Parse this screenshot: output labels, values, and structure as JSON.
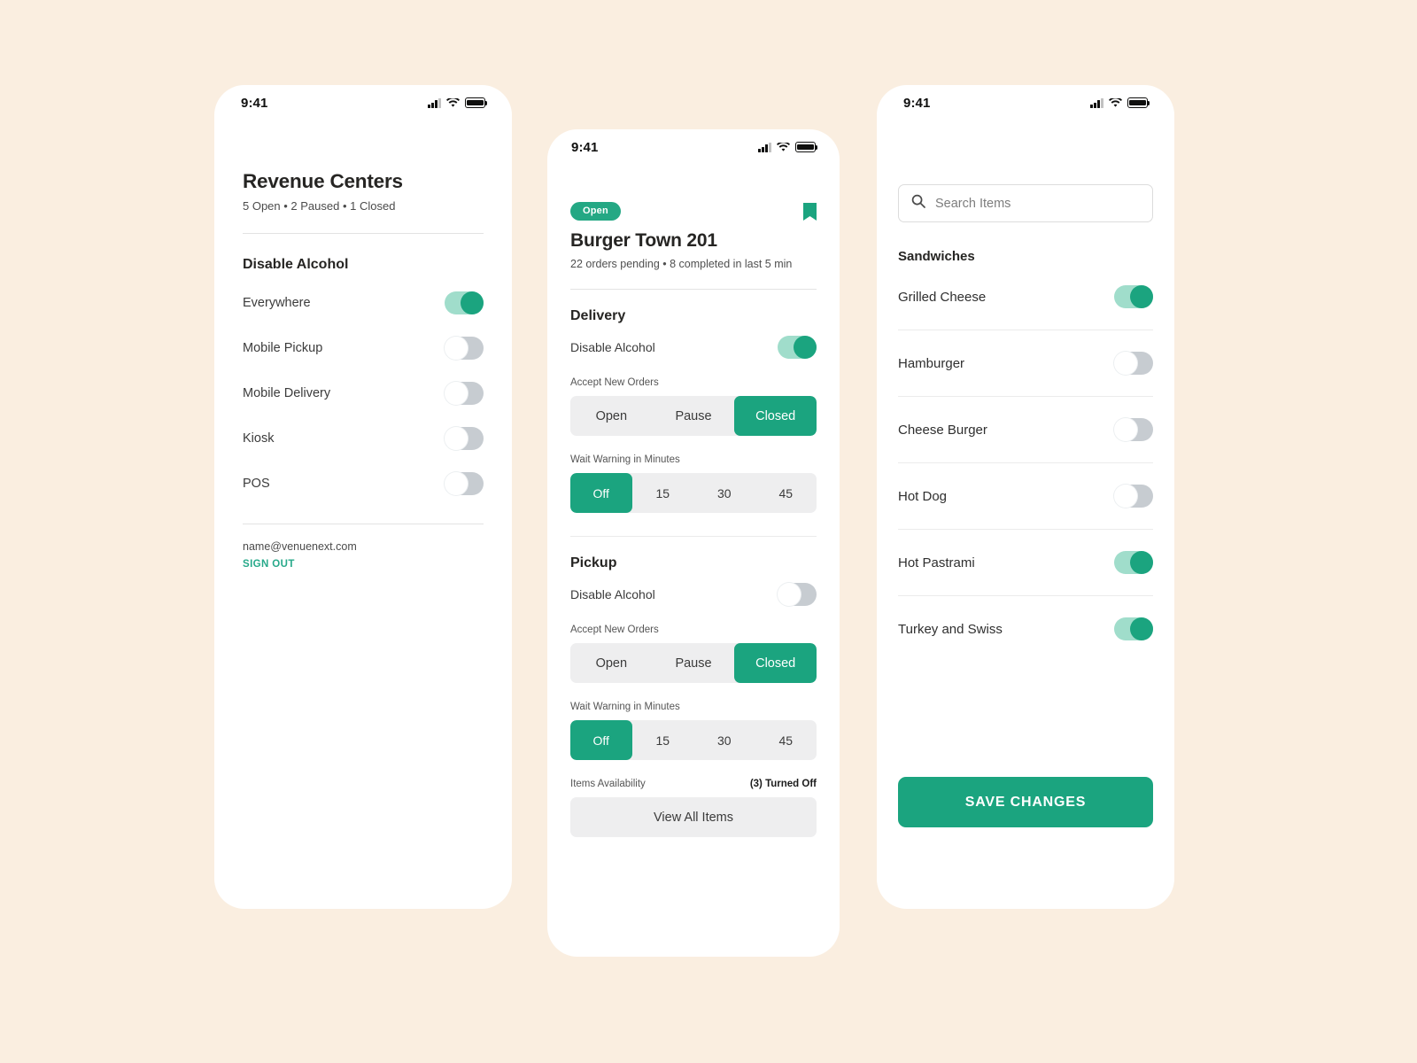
{
  "theme": {
    "background": "#faeee0",
    "accent": "#1ba47f",
    "accent_light": "#a0ddcb",
    "badge_green": "#24a884",
    "toggle_off": "#c7ccd1",
    "segment_bg": "#eeeeef",
    "text_dark": "#262523"
  },
  "status_bar": {
    "time": "9:41",
    "signal_icon": "cellular-signal-icon",
    "wifi_icon": "wifi-icon",
    "battery_icon": "battery-full-icon"
  },
  "phone1": {
    "title": "Revenue Centers",
    "subtitle": "5 Open • 2 Paused • 1 Closed",
    "section_title": "Disable Alcohol",
    "rows": [
      {
        "label": "Everywhere",
        "state": "on"
      },
      {
        "label": "Mobile Pickup",
        "state": "off"
      },
      {
        "label": "Mobile Delivery",
        "state": "off"
      },
      {
        "label": "Kiosk",
        "state": "off"
      },
      {
        "label": "POS",
        "state": "off"
      }
    ],
    "account_email": "name@venuenext.com",
    "sign_out_label": "SIGN OUT"
  },
  "phone2": {
    "status_badge": "Open",
    "bookmark_icon": "bookmark-icon",
    "title": "Burger Town 201",
    "subtitle": "22 orders pending • 8 completed in last 5 min",
    "delivery": {
      "heading": "Delivery",
      "disable_alcohol_label": "Disable Alcohol",
      "disable_alcohol_state": "on",
      "accept_orders_label": "Accept New Orders",
      "accept_orders_options": [
        "Open",
        "Pause",
        "Closed"
      ],
      "accept_orders_selected": "Closed",
      "wait_warning_label": "Wait Warning in Minutes",
      "wait_warning_options": [
        "Off",
        "15",
        "30",
        "45"
      ],
      "wait_warning_selected": "Off"
    },
    "pickup": {
      "heading": "Pickup",
      "disable_alcohol_label": "Disable Alcohol",
      "disable_alcohol_state": "off",
      "accept_orders_label": "Accept New Orders",
      "accept_orders_options": [
        "Open",
        "Pause",
        "Closed"
      ],
      "accept_orders_selected": "Closed",
      "wait_warning_label": "Wait Warning in Minutes",
      "wait_warning_options": [
        "Off",
        "15",
        "30",
        "45"
      ],
      "wait_warning_selected": "Off"
    },
    "items_availability_label": "Items Availability",
    "items_turned_off": "(3) Turned Off",
    "view_all_items_label": "View All Items"
  },
  "phone3": {
    "search_placeholder": "Search Items",
    "search_icon": "search-icon",
    "category": "Sandwiches",
    "items": [
      {
        "label": "Grilled Cheese",
        "state": "on"
      },
      {
        "label": "Hamburger",
        "state": "off"
      },
      {
        "label": "Cheese Burger",
        "state": "off"
      },
      {
        "label": "Hot Dog",
        "state": "off"
      },
      {
        "label": "Hot Pastrami",
        "state": "on"
      },
      {
        "label": "Turkey and Swiss",
        "state": "on"
      }
    ],
    "save_label": "SAVE CHANGES"
  }
}
